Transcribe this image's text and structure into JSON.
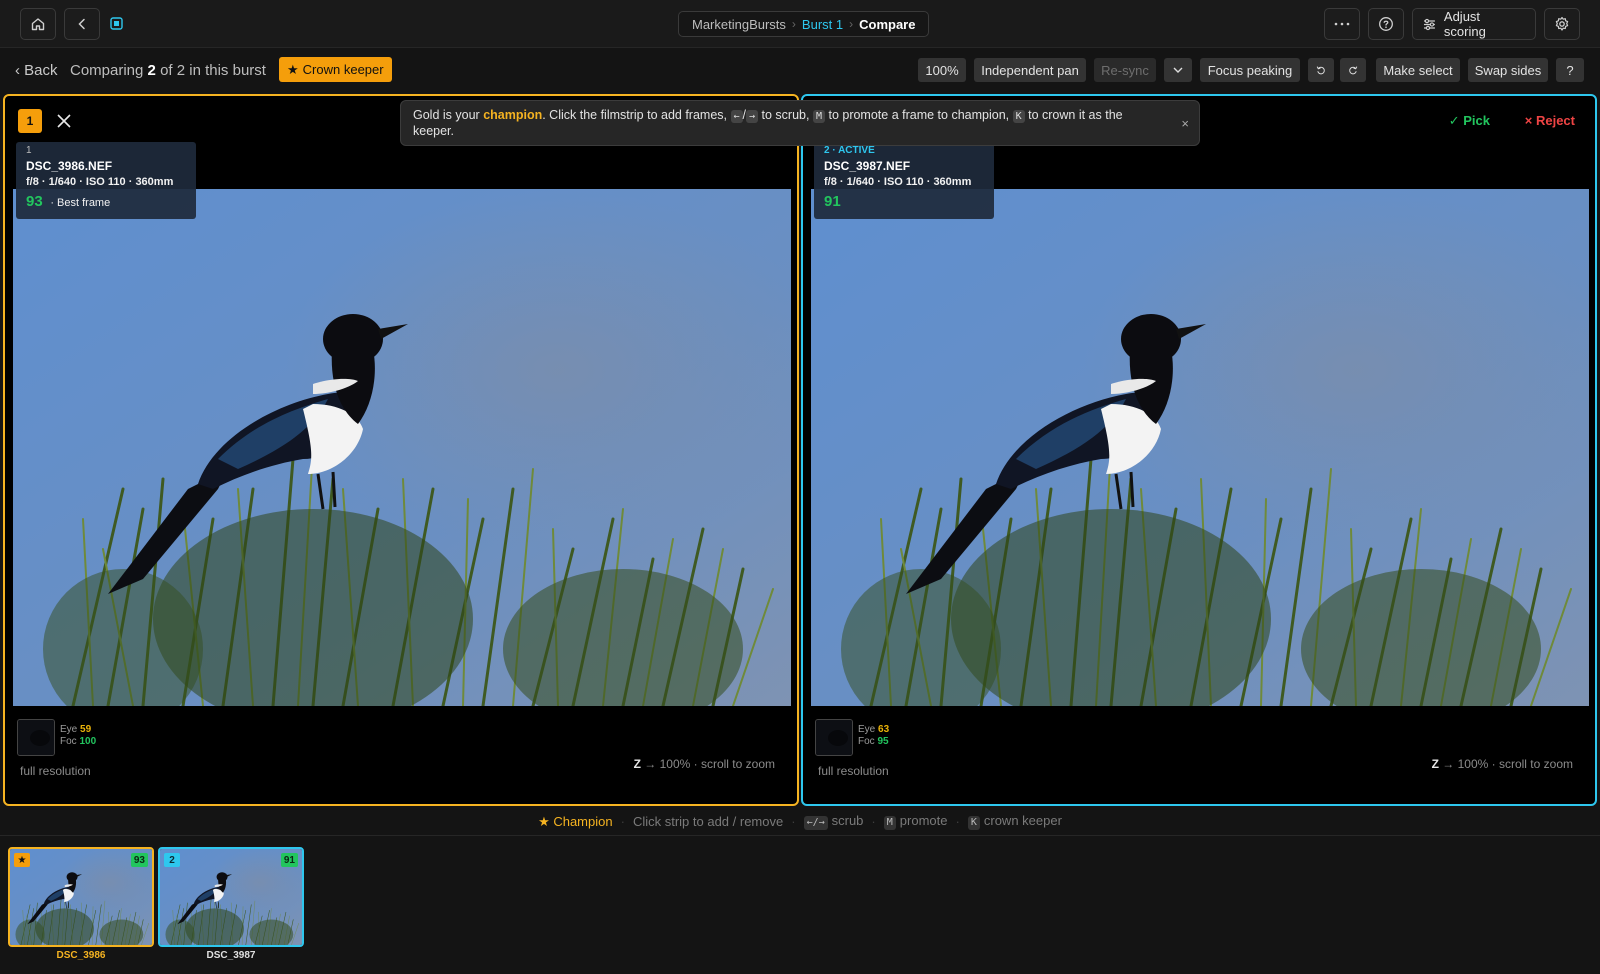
{
  "topbar": {
    "breadcrumb": [
      "MarketingBursts",
      "Burst 1",
      "Compare"
    ],
    "adjust_label": "Adjust scoring"
  },
  "subbar": {
    "back_label": "Back",
    "comparing_prefix": "Comparing",
    "comparing_count": "2",
    "comparing_suffix": "of 2 in this burst",
    "crown_label": "Crown keeper",
    "tools": {
      "zoom": "100%",
      "independent_pan": "Independent pan",
      "resync": "Re-sync",
      "focus_peaking": "Focus peaking",
      "make_select": "Make select",
      "swap_sides": "Swap sides",
      "help": "?"
    }
  },
  "tip": {
    "part1": "Gold is your",
    "champion": "champion",
    "part2": ". Click the filmstrip to add frames,",
    "key_left": "←",
    "slash": "/",
    "key_right": "→",
    "part3": "to scrub,",
    "key_m": "M",
    "part4": "to promote a frame to champion,",
    "key_k": "K",
    "part5": "to crown it as the keeper.",
    "close": "×"
  },
  "left_pane": {
    "rank": "1",
    "index_label": "1",
    "filename": "DSC_3986.NEF",
    "meta": "f/8 · 1/640 · ISO 110 · 360mm",
    "score": "93",
    "score_note": "· Best frame",
    "eye_label": "Eye",
    "eye_value": "59",
    "foc_label": "Foc",
    "foc_value": "100",
    "resolution": "full resolution",
    "zoom_key": "Z",
    "zoom_hint": "→ 100% · scroll to zoom"
  },
  "right_pane": {
    "index_label": "2 · ACTIVE",
    "filename": "DSC_3987.NEF",
    "meta": "f/8 · 1/640 · ISO 110 · 360mm",
    "score": "91",
    "pick_label": "✓ Pick",
    "reject_label": "× Reject",
    "eye_label": "Eye",
    "eye_value": "63",
    "foc_label": "Foc",
    "foc_value": "95",
    "resolution": "full resolution",
    "zoom_key": "Z",
    "zoom_hint": "→ 100% · scroll to zoom"
  },
  "hintbar": {
    "champion": "★ Champion",
    "click_strip": "Click strip to add / remove",
    "scrub_keys": "←/→",
    "scrub": "scrub",
    "promote_key": "M",
    "promote": "promote",
    "crown_key": "K",
    "crown": "crown keeper"
  },
  "filmstrip": [
    {
      "badge": "★",
      "score": "93",
      "label": "DSC_3986"
    },
    {
      "badge": "2",
      "score": "91",
      "label": "DSC_3987"
    }
  ],
  "colors": {
    "champion": "#f5b321",
    "active": "#2ec7ee",
    "score_good": "#22c55e",
    "reject": "#ef4444"
  }
}
